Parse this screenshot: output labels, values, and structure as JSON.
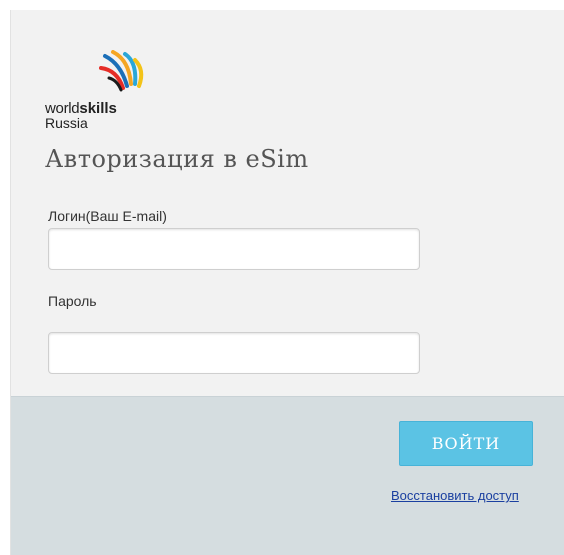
{
  "logo": {
    "word_world": "world",
    "word_skills": "skills",
    "word_country": "Russia",
    "colors": [
      "#f5a623",
      "#e52d27",
      "#1b6fb8",
      "#2aa7d8",
      "#f3c318",
      "#1b1b1b"
    ]
  },
  "title": "Авторизация в eSim",
  "login": {
    "label": "Логин(Ваш E-mail)",
    "value": "",
    "placeholder": ""
  },
  "password": {
    "label": "Пароль",
    "value": "",
    "placeholder": ""
  },
  "actions": {
    "submit_label": "ВОЙТИ",
    "restore_label": "Восстановить доступ"
  },
  "colors": {
    "panel_bg": "#f2f2f2",
    "footer_bg": "#d5dde0",
    "button_bg": "#5bc3e4",
    "link": "#1a3fa0"
  }
}
